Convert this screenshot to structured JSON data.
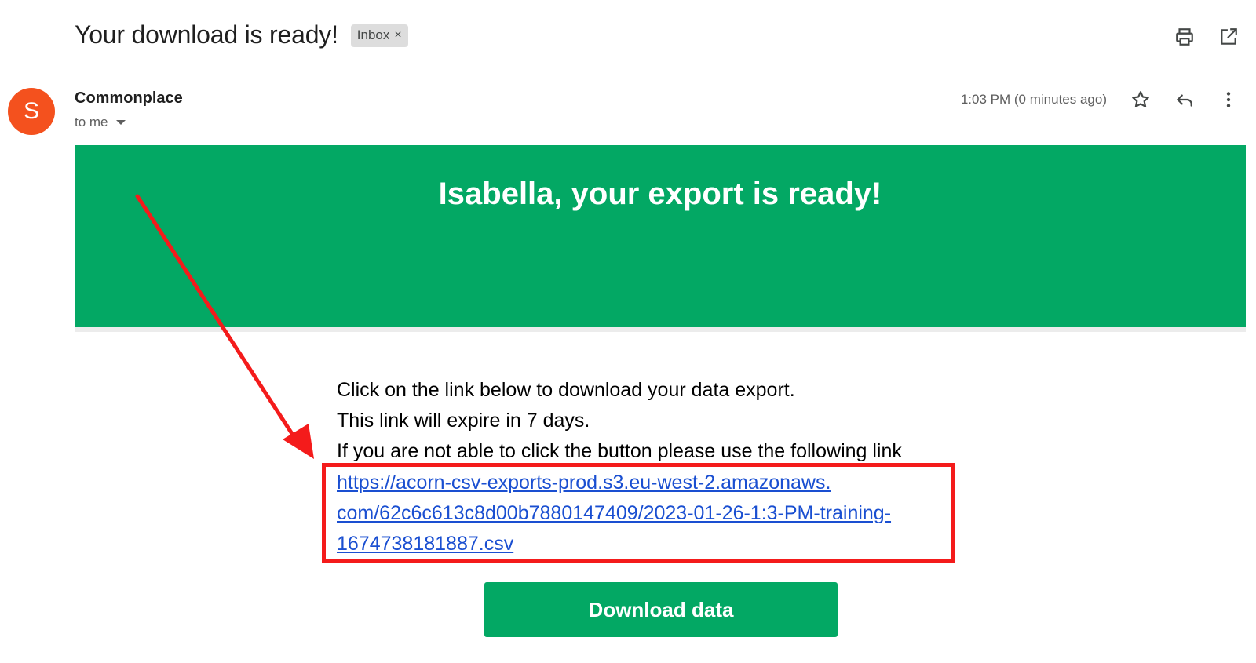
{
  "email": {
    "subject": "Your download is ready!",
    "label": "Inbox",
    "label_close": "×",
    "sender": {
      "initial": "S",
      "name": "Commonplace",
      "recipient": "to me"
    },
    "timestamp": "1:03 PM (0 minutes ago)",
    "actions": [
      "print-icon",
      "open-new-window-icon",
      "star-icon",
      "reply-icon",
      "more-vertical-icon"
    ],
    "banner": {
      "title": "Isabella, your export is ready!",
      "color": "#03a864"
    },
    "body_lines": [
      "Click on the link below to download your data export.",
      "This link will expire in 7 days.",
      "If you are not able to click the button please use the following link"
    ],
    "link_lines": [
      "https://acorn-csv-exports-prod.s3.eu-west-2.amazonaws.",
      "com/62c6c613c8d00b7880147409/2023-01-26-1:3-PM-training-",
      "1674738181887.csv"
    ],
    "button_label": "Download data"
  },
  "annotation": {
    "arrow_color": "#f41b1b",
    "highlight_color": "#f41b1b"
  },
  "avatar_color": "#f4511e"
}
